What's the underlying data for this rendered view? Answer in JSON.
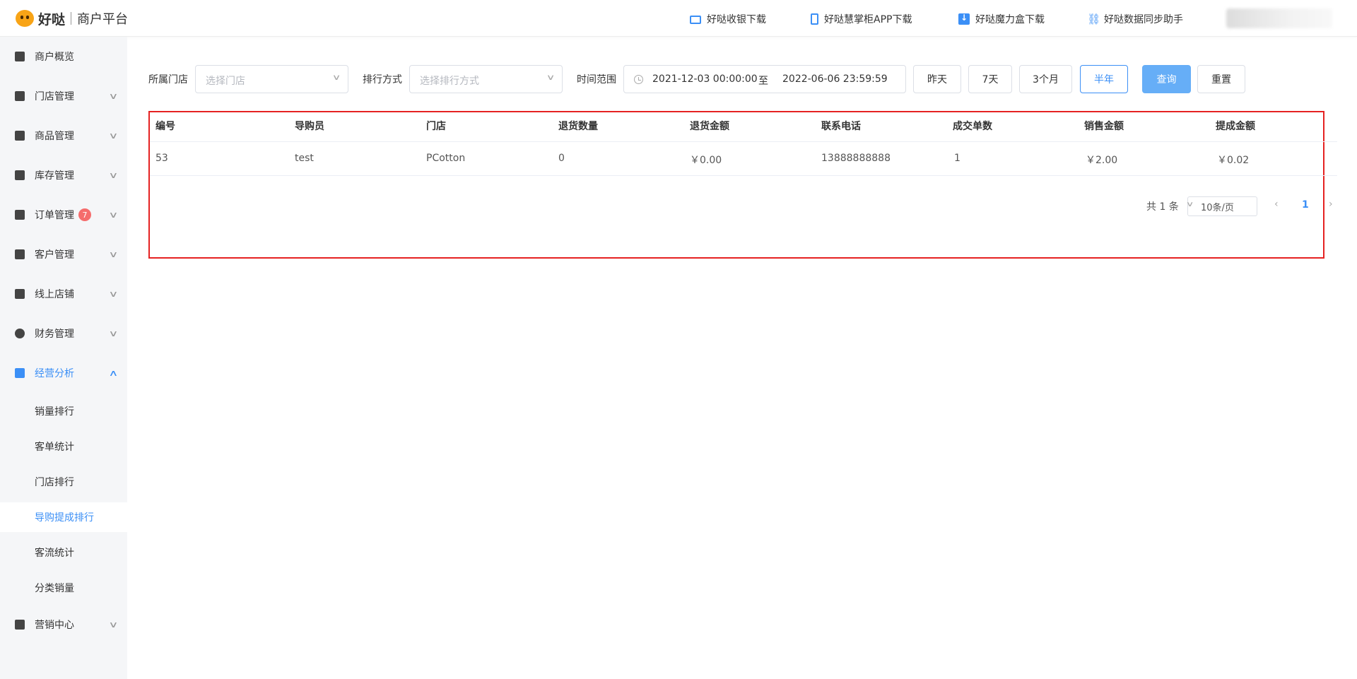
{
  "header": {
    "brand": "好哒",
    "platform": "商户平台",
    "links": [
      {
        "label": "好哒收银下载"
      },
      {
        "label": "好哒慧掌柜APP下载"
      },
      {
        "label": "好哒魔力盒下载"
      },
      {
        "label": "好哒数据同步助手"
      }
    ]
  },
  "sidebar": {
    "items": [
      {
        "label": "商户概览",
        "icon": "home-icon"
      },
      {
        "label": "门店管理",
        "icon": "store-icon"
      },
      {
        "label": "商品管理",
        "icon": "goods-icon"
      },
      {
        "label": "库存管理",
        "icon": "box-icon"
      },
      {
        "label": "订单管理",
        "icon": "order-icon",
        "badge": "7"
      },
      {
        "label": "客户管理",
        "icon": "customer-icon"
      },
      {
        "label": "线上店铺",
        "icon": "shop-icon"
      },
      {
        "label": "财务管理",
        "icon": "yen-icon"
      },
      {
        "label": "经营分析",
        "icon": "chart-icon",
        "active": true
      },
      {
        "label": "营销中心",
        "icon": "marketing-icon"
      }
    ],
    "sub_items": [
      {
        "label": "销量排行"
      },
      {
        "label": "客单统计"
      },
      {
        "label": "门店排行"
      },
      {
        "label": "导购提成排行",
        "selected": true
      },
      {
        "label": "客流统计"
      },
      {
        "label": "分类销量"
      }
    ]
  },
  "filters": {
    "store_label": "所属门店",
    "store_placeholder": "选择门店",
    "sort_label": "排行方式",
    "sort_placeholder": "选择排行方式",
    "time_label": "时间范围",
    "start": "2021-12-03 00:00:00",
    "to": "至",
    "end": "2022-06-06 23:59:59",
    "quick": [
      "昨天",
      "7天",
      "3个月",
      "半年"
    ],
    "selected_quick": "半年",
    "query": "查询",
    "reset": "重置"
  },
  "table": {
    "columns": [
      "编号",
      "导购员",
      "门店",
      "退货数量",
      "退货金额",
      "联系电话",
      "成交单数",
      "销售金额",
      "提成金额"
    ],
    "rows": [
      [
        "53",
        "test",
        "PCotton",
        "0",
        "￥0.00",
        "13888888888",
        "1",
        "￥2.00",
        "￥0.02"
      ]
    ]
  },
  "pagination": {
    "total": "共 1 条",
    "page_size": "10条/页",
    "current": "1"
  },
  "colors": {
    "accent": "#3b8ff6",
    "highlight_border": "#e52222",
    "badge": "#f56c6c"
  }
}
